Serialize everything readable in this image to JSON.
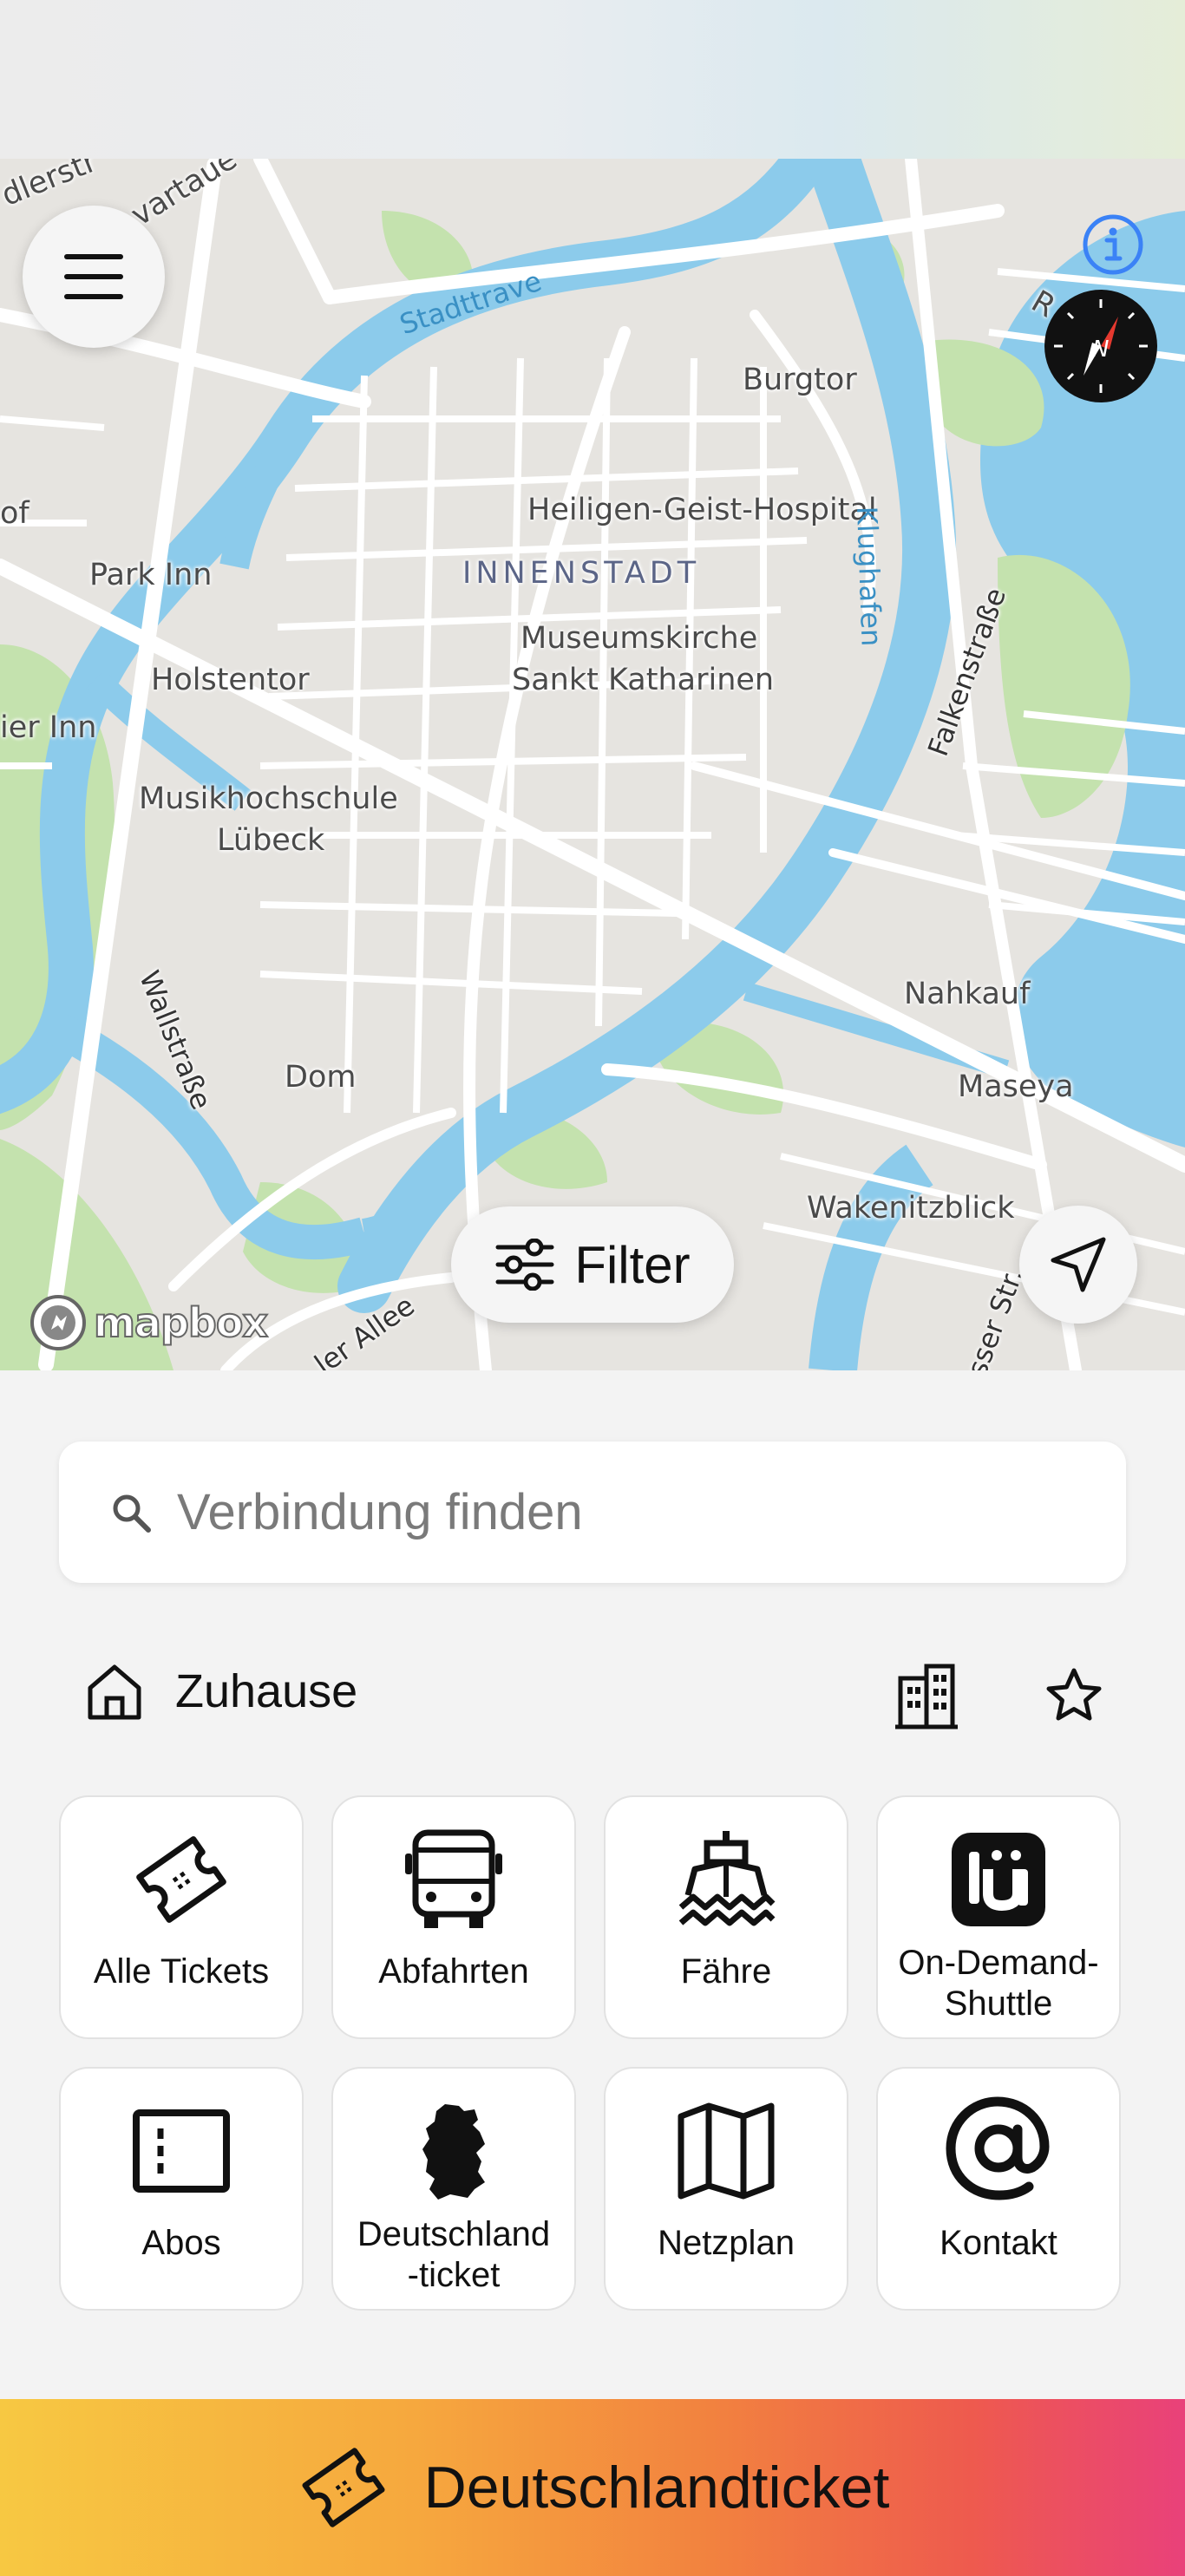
{
  "map": {
    "labels": {
      "burgtor": "Burgtor",
      "heiligen_geist": "Heiligen-Geist-Hospital",
      "innenstadt": "INNENSTADT",
      "museumskirche_1": "Museumskirche",
      "museumskirche_2": "Sankt Katharinen",
      "park_inn": "Park Inn",
      "holstentor": "Holstentor",
      "ier_inn": "ier Inn",
      "of": "of",
      "musikhochschule_1": "Musikhochschule",
      "musikhochschule_2": "Lübeck",
      "wallstrasse": "Wallstraße",
      "dom": "Dom",
      "nahkauf": "Nahkauf",
      "maseya": "Maseya",
      "wakenitzblick": "Wakenitzblick",
      "falkenstrasse": "Falkenstraße",
      "klughafen": "Klughafen",
      "stadttrave": "Stadttrave",
      "ler_allee": "ler Allee",
      "sser_str": "sser Str.",
      "adlerstr": "dlerstr",
      "wartauer": "vartaue",
      "ro": "R",
      "mapbox": "mapbox"
    }
  },
  "filter": {
    "label": "Filter"
  },
  "search": {
    "placeholder": "Verbindung finden",
    "value": ""
  },
  "favorites": {
    "home_label": "Zuhause"
  },
  "tiles": [
    {
      "label": "Alle Tickets",
      "icon": "ticket-icon"
    },
    {
      "label": "Abfahrten",
      "icon": "bus-icon"
    },
    {
      "label": "Fähre",
      "icon": "ferry-icon"
    },
    {
      "label": "On-Demand-Shuttle",
      "label_line1": "On-Demand-",
      "label_line2": "Shuttle",
      "icon": "lue-shuttle-icon"
    },
    {
      "label": "Abos",
      "icon": "subscription-icon"
    },
    {
      "label": "Deutschland-ticket",
      "label_line1": "Deutschland",
      "label_line2": "-ticket",
      "icon": "germany-map-icon"
    },
    {
      "label": "Netzplan",
      "icon": "network-map-icon"
    },
    {
      "label": "Kontakt",
      "icon": "at-icon"
    }
  ],
  "banner": {
    "label": "Deutschlandticket"
  },
  "colors": {
    "water": "#8ccbeb",
    "park": "#c4e2ae",
    "land": "#e6e4e0",
    "road": "#ffffff",
    "banner_start": "#f7c842",
    "banner_end": "#e9417a"
  }
}
